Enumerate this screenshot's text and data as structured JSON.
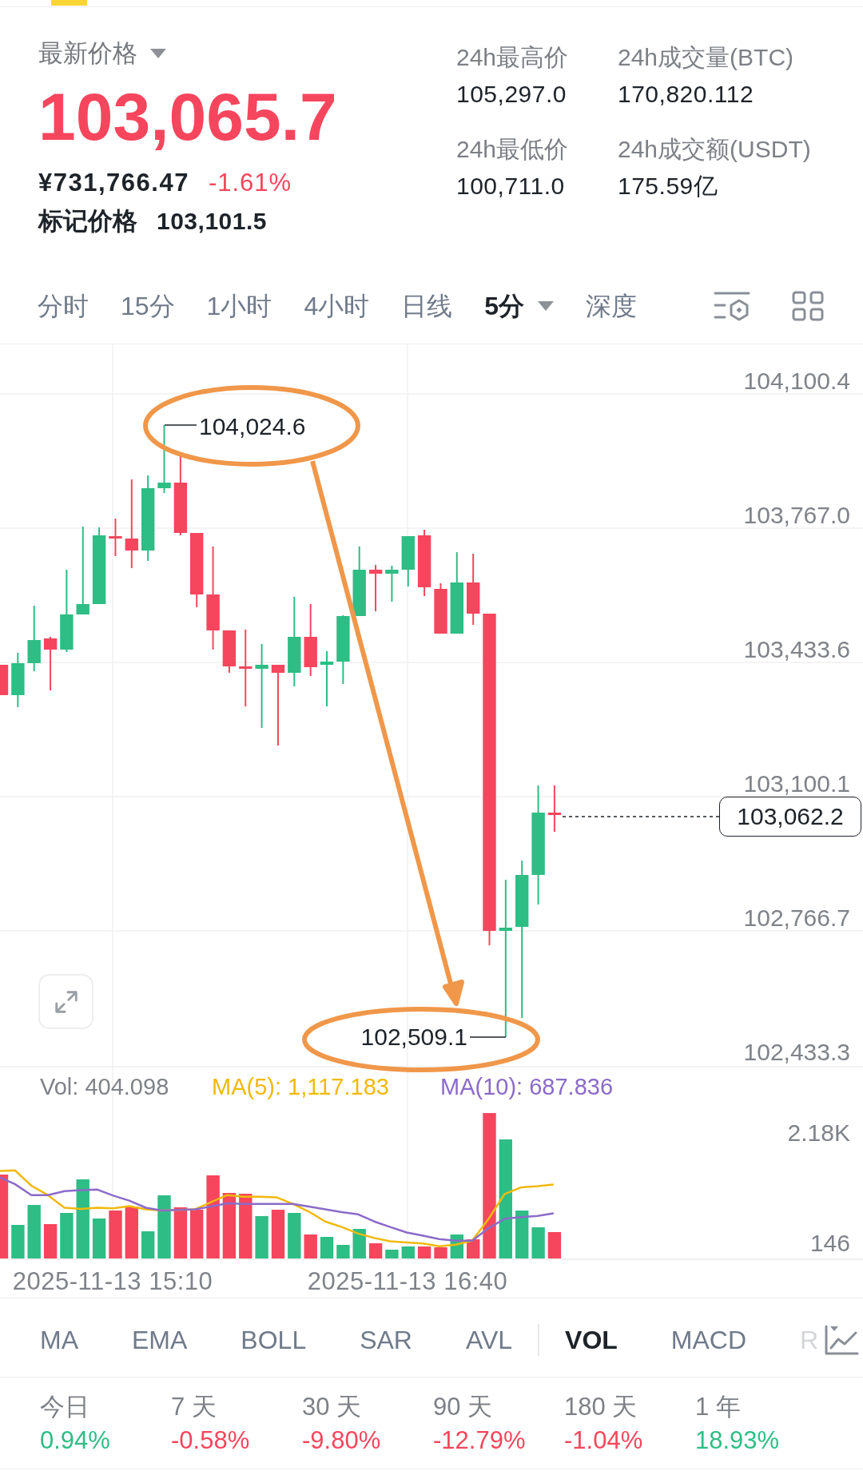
{
  "ticker": {
    "price_label": "最新价格",
    "price": "103,065.7",
    "falling": true,
    "cny_price": "¥731,766.47",
    "change": "-1.61%",
    "mark_price_label": "标记价格",
    "mark_price": "103,101.5"
  },
  "stats_24h": [
    {
      "label": "24h最高价",
      "value": "105,297.0"
    },
    {
      "label": "24h成交量(BTC)",
      "value": "170,820.112"
    },
    {
      "label": "24h最低价",
      "value": "100,711.0"
    },
    {
      "label": "24h成交额(USDT)",
      "value": "175.59亿"
    }
  ],
  "timeframes": [
    {
      "label": "分时",
      "selected": false,
      "dropdown": false
    },
    {
      "label": "15分",
      "selected": false,
      "dropdown": false
    },
    {
      "label": "1小时",
      "selected": false,
      "dropdown": false
    },
    {
      "label": "4小时",
      "selected": false,
      "dropdown": false
    },
    {
      "label": "日线",
      "selected": false,
      "dropdown": false
    },
    {
      "label": "5分",
      "selected": true,
      "dropdown": true
    },
    {
      "label": "深度",
      "selected": false,
      "dropdown": false
    }
  ],
  "chart": {
    "price_ticks": [
      "104,100.4",
      "103,767.0",
      "103,433.6",
      "103,100.1",
      "102,766.7",
      "102,433.3"
    ],
    "high_marker": "104,024.6",
    "low_marker": "102,509.1",
    "current_price": "103,062.2",
    "volume_legend": [
      {
        "kind": "vol",
        "text": "Vol: 404.098"
      },
      {
        "kind": "ma5",
        "text": "MA(5): 1,117.183"
      },
      {
        "kind": "ma10",
        "text": "MA(10): 687.836"
      }
    ],
    "volume_ticks": [
      "2.18K",
      "146"
    ],
    "time_labels": [
      "2025-11-13 15:10",
      "2025-11-13 16:40"
    ]
  },
  "indicators": {
    "main": [
      {
        "label": "MA",
        "selected": false,
        "faded": false
      },
      {
        "label": "EMA",
        "selected": false,
        "faded": false
      },
      {
        "label": "BOLL",
        "selected": false,
        "faded": false
      },
      {
        "label": "SAR",
        "selected": false,
        "faded": false
      },
      {
        "label": "AVL",
        "selected": false,
        "faded": false
      }
    ],
    "sub": [
      {
        "label": "VOL",
        "selected": true,
        "faded": false
      },
      {
        "label": "MACD",
        "selected": false,
        "faded": false
      },
      {
        "label": "R",
        "selected": false,
        "faded": true
      }
    ]
  },
  "period_returns": [
    {
      "label": "今日",
      "value": "0.94%",
      "color": "#2ebd85"
    },
    {
      "label": "7 天",
      "value": "-0.58%",
      "color": "#f6465d"
    },
    {
      "label": "30 天",
      "value": "-9.80%",
      "color": "#f6465d"
    },
    {
      "label": "90 天",
      "value": "-12.79%",
      "color": "#f6465d"
    },
    {
      "label": "180 天",
      "value": "-1.04%",
      "color": "#f6465d"
    },
    {
      "label": "1 年",
      "value": "18.93%",
      "color": "#2ebd85"
    }
  ]
}
